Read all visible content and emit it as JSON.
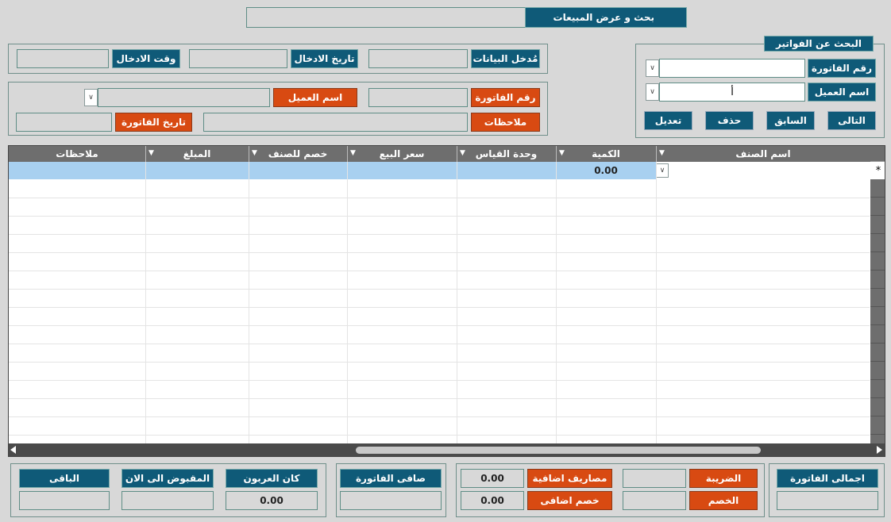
{
  "header": {
    "title": "بحث و عرض المبيعات"
  },
  "search_panel": {
    "title": "البحث عن الفواتير",
    "invoice_number_label": "رقم الفاتورة",
    "customer_name_label": "اسم العميل",
    "customer_name_value": "أ",
    "buttons": {
      "next": "التالى",
      "previous": "السابق",
      "delete": "حذف",
      "edit": "تعديل"
    }
  },
  "entry_info": {
    "data_entry_label": "مُدخل البيانات",
    "entry_date_label": "تاريخ الادخال",
    "entry_time_label": "وقت الادخال"
  },
  "invoice_info": {
    "invoice_number_label": "رقم الفاتورة",
    "customer_name_label": "اسم العميل",
    "notes_label": "ملاحظات",
    "invoice_date_label": "تاريخ الفاتورة"
  },
  "grid": {
    "columns": [
      "اسم الصنف",
      "الكمية",
      "وحدة القياس",
      "سعر البيع",
      "خصم للصنف",
      "المبلغ",
      "ملاحظات"
    ],
    "new_row": {
      "quantity": "0.00"
    },
    "new_row_marker": "*"
  },
  "totals": {
    "invoice_total_label": "اجمالى الفاتورة",
    "tax_label": "الضريبة",
    "discount_label": "الخصم",
    "extra_expenses_label": "مصاريف اضافية",
    "extra_expenses_value": "0.00",
    "extra_discount_label": "خصم اضافى",
    "extra_discount_value": "0.00",
    "net_invoice_label": "صافى الفاتورة",
    "deposit_label": "كان العربون",
    "deposit_value": "0.00",
    "paid_label": "المقبوض الى الان",
    "remaining_label": "الباقى"
  }
}
